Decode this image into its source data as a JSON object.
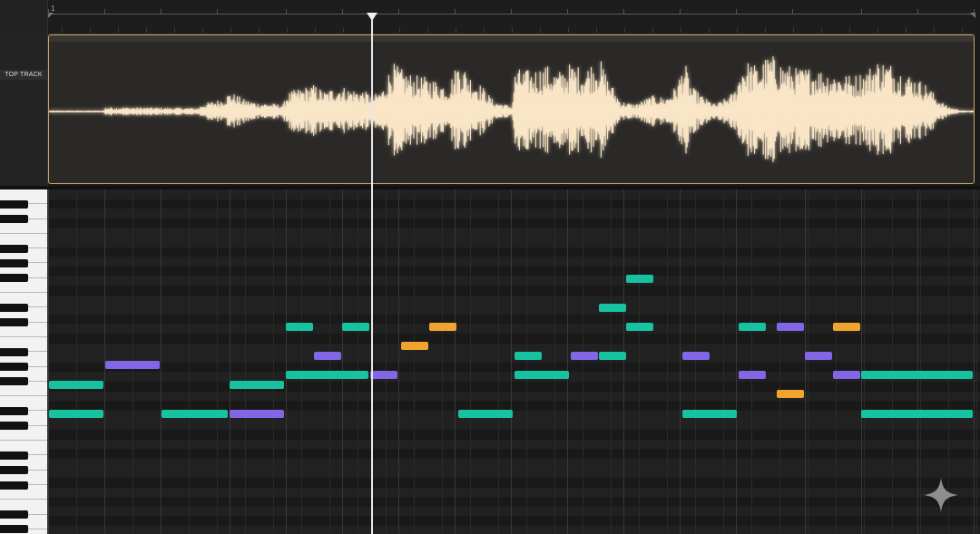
{
  "ruler": {
    "bar_number": "1"
  },
  "track": {
    "label": "TOP TRACK"
  },
  "colors": {
    "clip_border": "#c9a76a",
    "waveform": "#fbe7c8",
    "note_green": "#17c2a0",
    "note_purple": "#8266e6",
    "note_orange": "#f0a430"
  },
  "icons": {
    "playhead": "playhead-handle-icon",
    "sparkle": "sparkle-icon"
  },
  "notes": [
    {
      "color": "green"
    },
    {
      "color": "green"
    },
    {
      "color": "purple"
    },
    {
      "color": "green"
    },
    {
      "color": "green"
    },
    {
      "color": "purple"
    },
    {
      "color": "green"
    },
    {
      "color": "purple"
    },
    {
      "color": "green"
    },
    {
      "color": "green"
    },
    {
      "color": "purple"
    },
    {
      "color": "orange"
    },
    {
      "color": "orange"
    },
    {
      "color": "green"
    },
    {
      "color": "green"
    },
    {
      "color": "green"
    },
    {
      "color": "purple"
    },
    {
      "color": "green"
    },
    {
      "color": "green"
    },
    {
      "color": "green"
    },
    {
      "color": "green"
    },
    {
      "color": "purple"
    },
    {
      "color": "green"
    },
    {
      "color": "green"
    },
    {
      "color": "purple"
    },
    {
      "color": "purple"
    },
    {
      "color": "orange"
    },
    {
      "color": "purple"
    },
    {
      "color": "orange"
    },
    {
      "color": "purple"
    },
    {
      "color": "green"
    },
    {
      "color": "green"
    }
  ]
}
